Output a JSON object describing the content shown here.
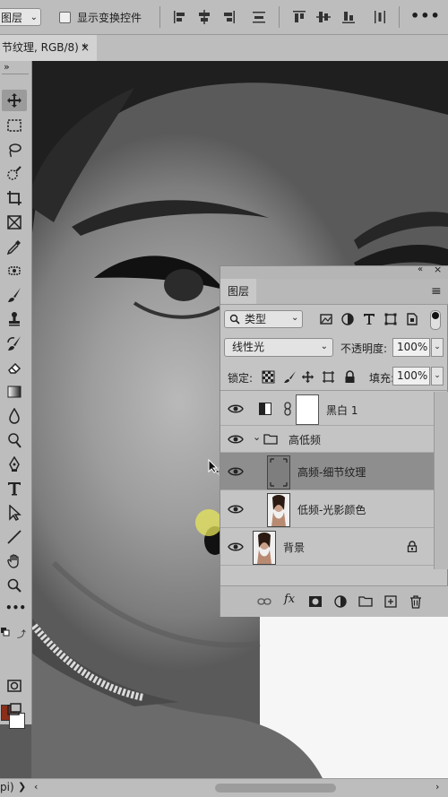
{
  "options_bar": {
    "layer_select": "图层",
    "show_transform_label": "显示变换控件",
    "more": "•••"
  },
  "document_tab": {
    "title": "节纹理, RGB/8) *",
    "close": "×"
  },
  "toolbar": {
    "collapse": "»",
    "more": "•••",
    "foreground_color": "#8a2e1a",
    "background_color": "#ffffff"
  },
  "layers_panel": {
    "tab_label": "图层",
    "collapse": "«",
    "close": "×",
    "filter_label": "类型",
    "blend_mode": "线性光",
    "opacity_label": "不透明度:",
    "opacity_value": "100%",
    "lock_label": "锁定:",
    "fill_label": "填充:",
    "fill_value": "100%",
    "layers": [
      {
        "name": "黑白 1",
        "type": "adjustment"
      },
      {
        "name": "高低频",
        "type": "group"
      },
      {
        "name": "高频-细节纹理",
        "type": "layer",
        "selected": true
      },
      {
        "name": "低频-光影颜色",
        "type": "layer"
      },
      {
        "name": "背景",
        "type": "background",
        "locked": true
      }
    ]
  },
  "status_bar": {
    "zoom": "pi)",
    "arrow": "❯"
  }
}
